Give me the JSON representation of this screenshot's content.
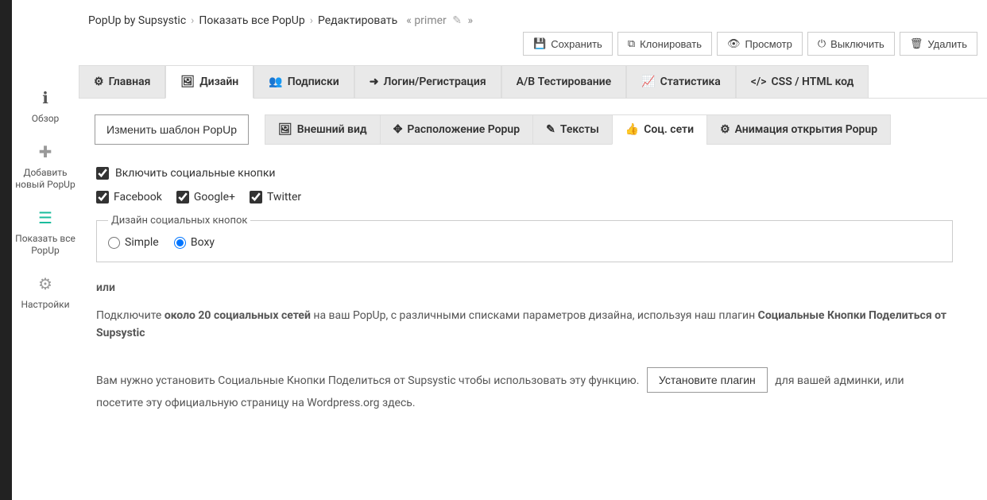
{
  "breadcrumbs": {
    "root": "PopUp by Supsystic",
    "all": "Показать все PopUp",
    "edit": "Редактировать",
    "title": "primer"
  },
  "actions": {
    "save": "Сохранить",
    "clone": "Клонировать",
    "preview": "Просмотр",
    "disable": "Выключить",
    "delete": "Удалить"
  },
  "sidebar": {
    "overview": "Обзор",
    "add_new": "Добавить новый PopUp",
    "show_all": "Показать все PopUp",
    "settings": "Настройки"
  },
  "tabs": {
    "main": "Главная",
    "design": "Дизайн",
    "subscriptions": "Подписки",
    "login": "Логин/Регистрация",
    "ab": "A/B Тестирование",
    "stats": "Статистика",
    "code": "CSS / HTML код"
  },
  "subtabs": {
    "appearance": "Внешний вид",
    "position": "Расположение Popup",
    "texts": "Тексты",
    "social": "Соц. сети",
    "animation": "Анимация открытия Popup"
  },
  "change_template": "Изменить шаблон PopUp",
  "social": {
    "enable_label": "Включить социальные кнопки",
    "facebook": "Facebook",
    "google": "Google+",
    "twitter": "Twitter",
    "fieldset_legend": "Дизайн социальных кнопок",
    "simple": "Simple",
    "boxy": "Boxy"
  },
  "or_text": "или",
  "help_text_1": "Подключите ",
  "help_text_bold_1": "около 20 социальных сетей",
  "help_text_2": " на ваш PopUp, с различными списками параметров дизайна, используя наш плагин ",
  "help_text_bold_2": "Социальные Кнопки Поделиться от Supsystic",
  "install_text_1": "Вам нужно установить Социальные Кнопки Поделиться от Supsystic чтобы использовать эту функцию.",
  "install_btn": "Установите плагин",
  "install_text_2": "для вашей админки, или посетите эту официальную страницу на Wordpress.org здесь."
}
